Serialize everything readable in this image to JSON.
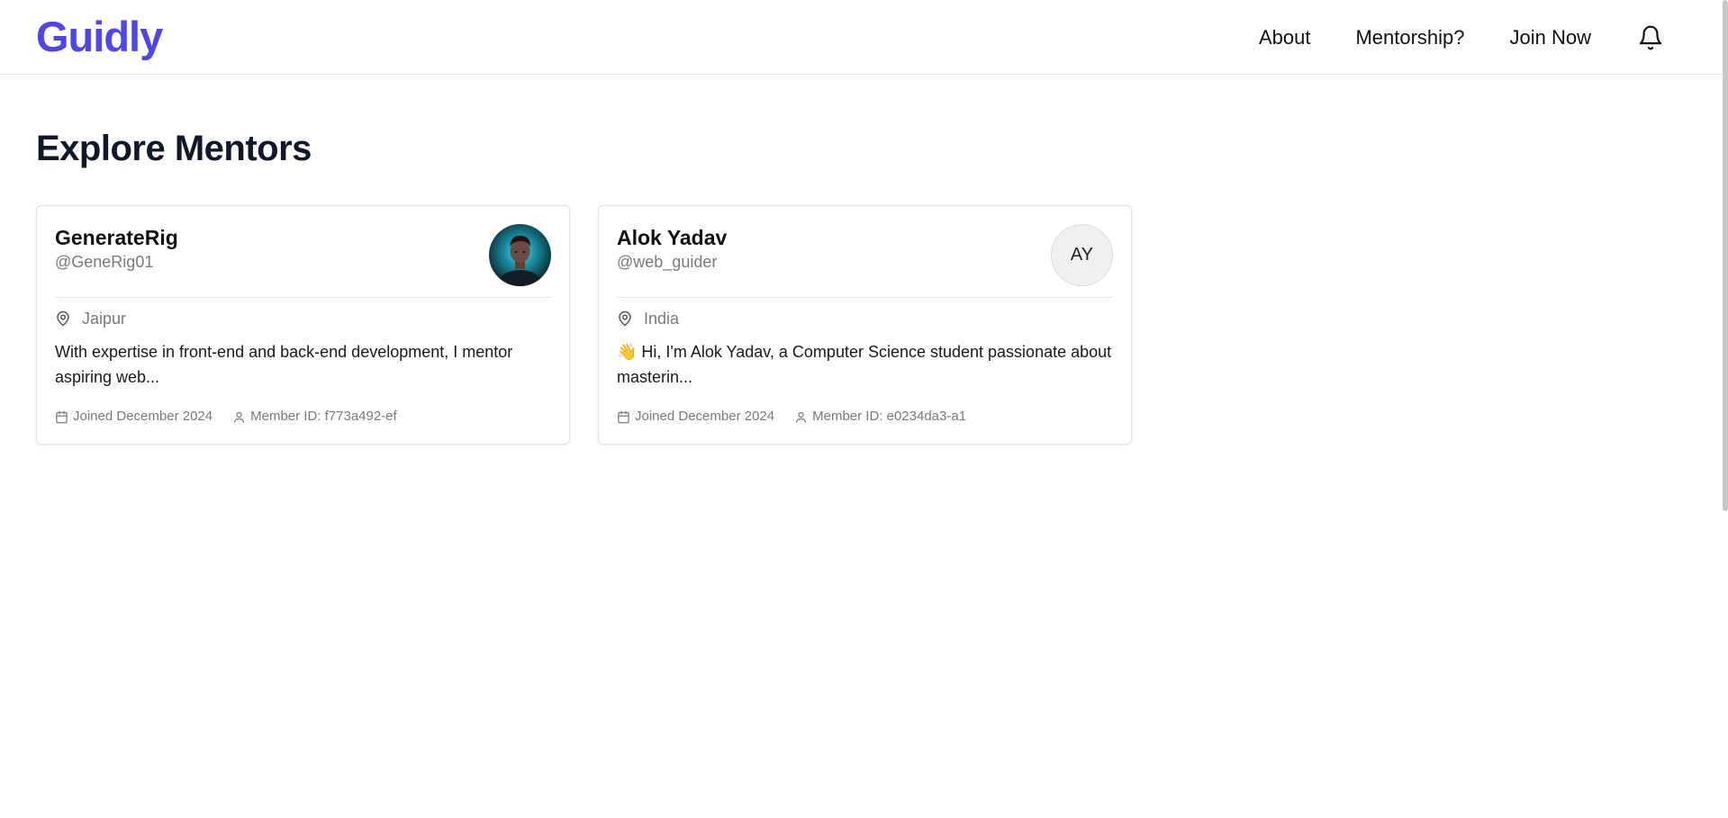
{
  "header": {
    "logo": "Guidly",
    "nav": {
      "about": "About",
      "mentorship": "Mentorship?",
      "join": "Join Now"
    },
    "bell_icon": "bell-icon"
  },
  "main": {
    "title": "Explore Mentors",
    "mentors": [
      {
        "name": "GenerateRig",
        "handle": "@GeneRig01",
        "avatar": "photo",
        "location": "Jaipur",
        "bio": "With expertise in front-end and back-end development, I mentor aspiring web...",
        "joined": "Joined December 2024",
        "member_id": "Member ID: f773a492-ef"
      },
      {
        "name": "Alok Yadav",
        "handle": "@web_guider",
        "avatar_initials": "AY",
        "location": "India",
        "bio": "👋 Hi, I'm Alok Yadav, a Computer Science student passionate about masterin...",
        "joined": "Joined December 2024",
        "member_id": "Member ID: e0234da3-a1"
      }
    ]
  },
  "colors": {
    "brand": "#4f46e5",
    "heading": "#111827",
    "muted": "#7a7a7a",
    "border": "#e5e7eb"
  }
}
